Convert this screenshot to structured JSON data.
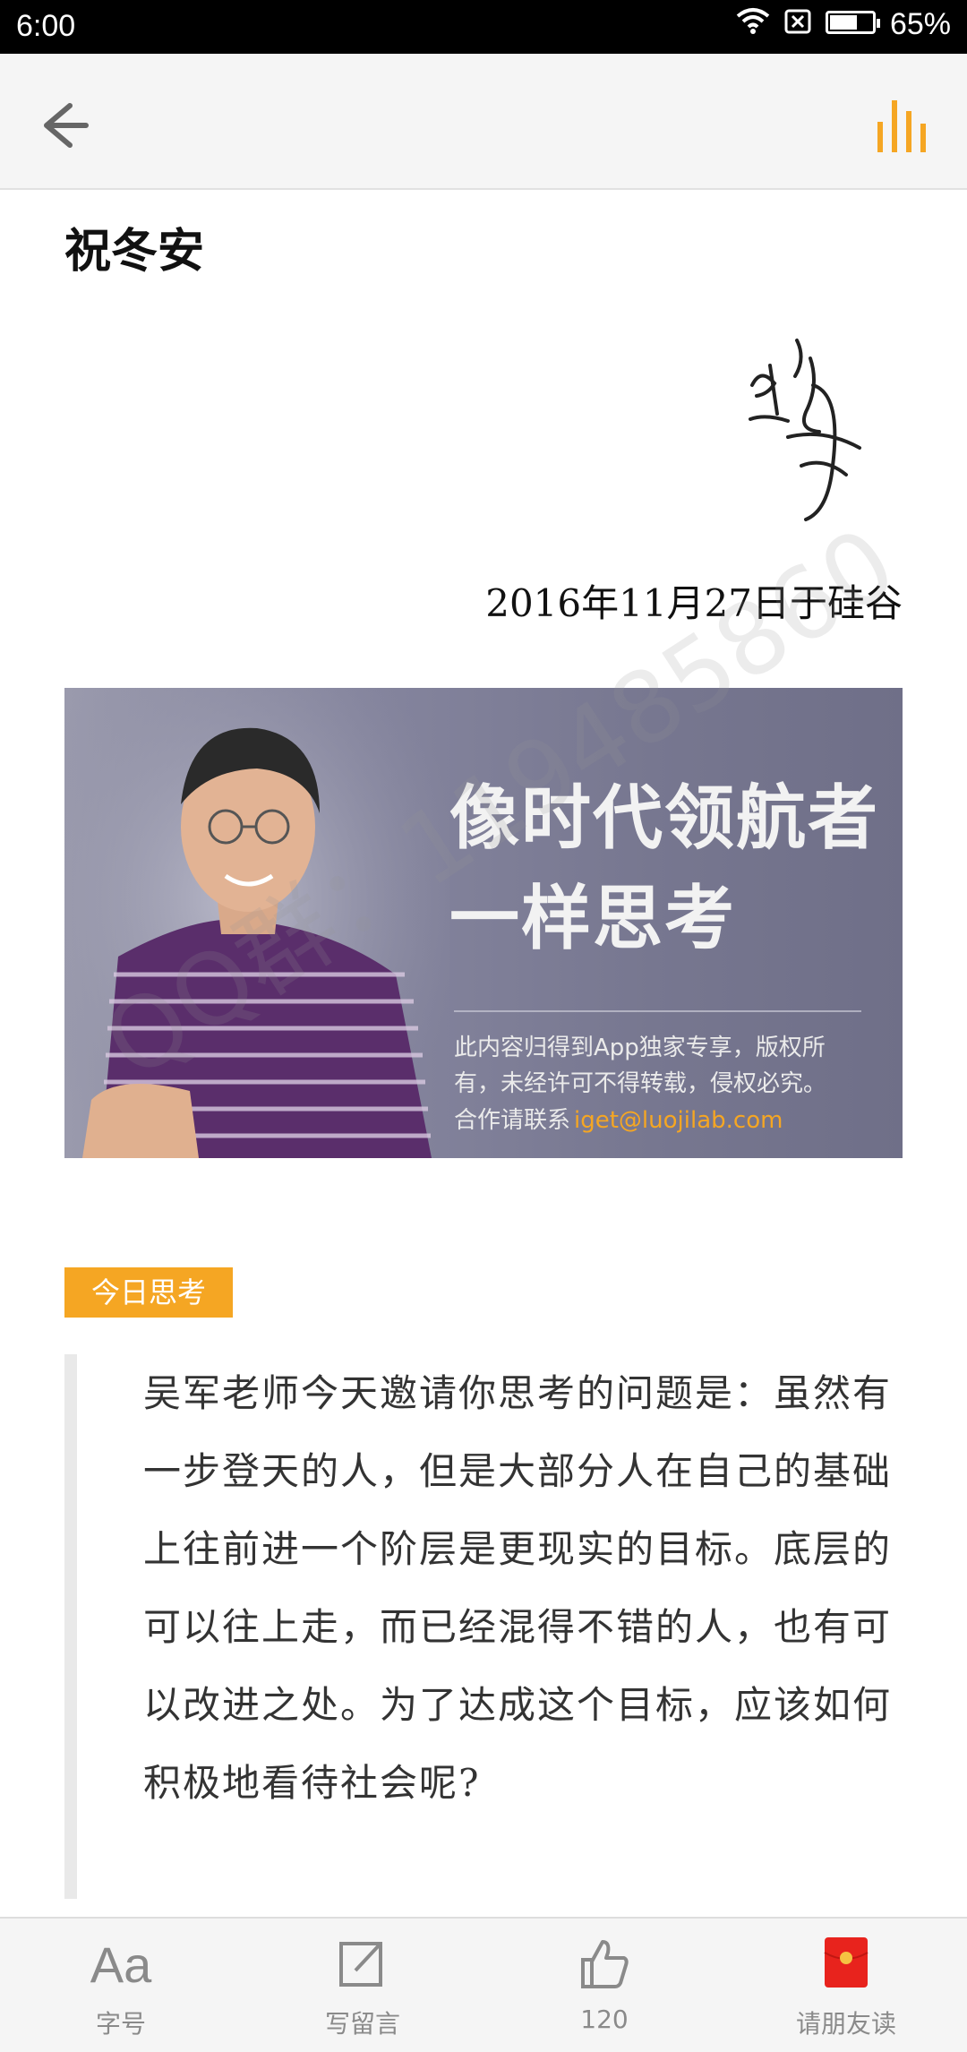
{
  "status_bar": {
    "time": "6:00",
    "battery_percent": "65%",
    "battery_level": 0.65,
    "icons": [
      "wifi-icon",
      "sim-off-icon",
      "battery-icon"
    ]
  },
  "app_bar": {
    "back_icon": "arrow-left-icon",
    "audio_icon": "audio-bars-icon",
    "accent_color": "#f5a623"
  },
  "article": {
    "closing": "祝冬安",
    "date_line": "2016年11月27日于硅谷"
  },
  "banner": {
    "title_line1": "像时代领航者",
    "title_line2": "一样思考",
    "notice_line1": "此内容归得到App独家专享，版权所",
    "notice_line2": "有，未经许可不得转载，侵权必究。",
    "contact_label": "合作请联系",
    "contact_email": "iget@luojilab.com"
  },
  "watermark": "QQ群：119485860",
  "thought": {
    "tag": "今日思考",
    "question": "吴军老师今天邀请你思考的问题是：虽然有一步登天的人，但是大部分人在自己的基础上往前进一个阶层是更现实的目标。底层的可以往上走，而已经混得不错的人，也有可以改进之处。为了达成这个目标，应该如何积极地看待社会呢?"
  },
  "toolbar": {
    "font_icon_text": "Aa",
    "font_label": "字号",
    "comment_label": "写留言",
    "like_count": "120",
    "share_label": "请朋友读"
  }
}
